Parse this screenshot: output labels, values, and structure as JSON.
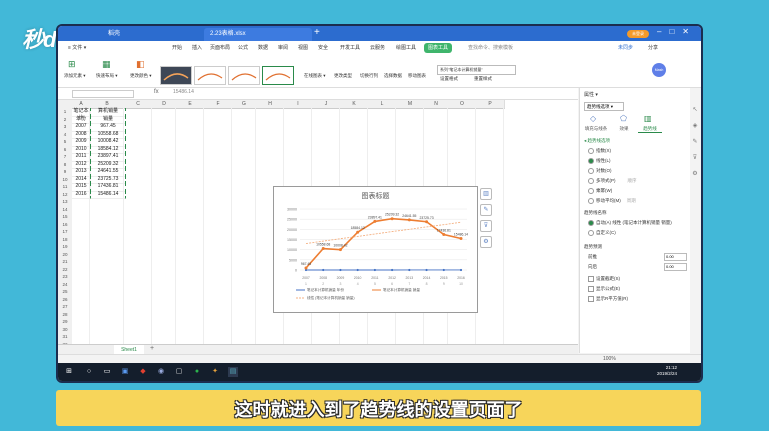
{
  "logo": "秒dong视频",
  "window": {
    "tabs": [
      "稻壳",
      "2.23表格.xlsx"
    ],
    "login_button": "未登录"
  },
  "menubar": {
    "items": [
      "≡ 文件 ▾",
      "开始",
      "插入",
      "页面布局",
      "公式",
      "数据",
      "审阅",
      "视图",
      "安全",
      "开发工具",
      "云服务",
      "绘图工具",
      "图表工具",
      "查找命令、搜索模板"
    ],
    "share": "分享",
    "sync": "未同步"
  },
  "ribbon": {
    "buttons": [
      "添加元素 ▾",
      "快速布局 ▾",
      "更改颜色 ▾",
      "在线图表 ▾",
      "更改类型",
      "切换行列",
      "选择数据",
      "移动图表",
      "设置格式",
      "重置样式"
    ],
    "series_select": "系列\"笔记本计算机销量\"",
    "avatar": "Mash"
  },
  "formula": {
    "fx": "fx",
    "value": "15486.14"
  },
  "sheet": {
    "columns": [
      "A",
      "B",
      "C",
      "D",
      "E",
      "F",
      "G",
      "H",
      "I",
      "J",
      "K",
      "L",
      "M",
      "N",
      "O",
      "P"
    ],
    "rows": [
      "1",
      "2",
      "3",
      "4",
      "5",
      "6",
      "7",
      "8",
      "9",
      "10",
      "11",
      "12",
      "13",
      "14",
      "15",
      "16",
      "17",
      "18",
      "19",
      "20",
      "21",
      "22",
      "23",
      "24",
      "25",
      "26",
      "27",
      "28",
      "29",
      "30",
      "31",
      "32",
      "33"
    ],
    "header_a1": "笔记本计",
    "header_a2": "年份",
    "header_b1": "算机销量",
    "header_b2": "销量",
    "years": [
      "2007",
      "2008",
      "2009",
      "2010",
      "2011",
      "2012",
      "2013",
      "2014",
      "2015",
      "2016"
    ],
    "sales": [
      "967.45",
      "10558.68",
      "10008.42",
      "18584.12",
      "23897.41",
      "25209.32",
      "24641.55",
      "23725.73",
      "17436.81",
      "15486.14"
    ],
    "tab": "Sheet1"
  },
  "chart_data": {
    "type": "line",
    "title": "图表标题",
    "x": [
      "2007",
      "2008",
      "2009",
      "2010",
      "2011",
      "2012",
      "2013",
      "2014",
      "2015",
      "2016"
    ],
    "xticks": [
      "1",
      "2",
      "3",
      "4",
      "5",
      "6",
      "7",
      "8",
      "9",
      "10"
    ],
    "ylim": [
      0,
      30000
    ],
    "yticks": [
      "0",
      "5000",
      "10000",
      "15000",
      "20000",
      "25000",
      "30000"
    ],
    "series": [
      {
        "name": "笔记本计算机销量 年份",
        "values": [
          1,
          2,
          3,
          4,
          5,
          6,
          7,
          8,
          9,
          10
        ],
        "color": "#4472c4"
      },
      {
        "name": "笔记本计算机销量 销量",
        "values": [
          967.45,
          10558.68,
          10008.42,
          18584.12,
          23897.41,
          25209.32,
          24641.55,
          23725.73,
          17436.81,
          15486.14
        ],
        "color": "#ed7d31"
      },
      {
        "name": "线性 (笔记本计算机销量 销量)",
        "values": [
          13000,
          14200,
          15400,
          16500,
          17700,
          18900,
          20000,
          21200,
          22300,
          23500
        ],
        "color": "#f4b183"
      }
    ],
    "data_labels": [
      "967.45",
      "10558.68",
      "10008.42",
      "18584.12",
      "23897.41",
      "25209.32",
      "24641.55",
      "23725.73",
      "17436.81",
      "15486.14"
    ],
    "legend": "bottom",
    "grid": true
  },
  "pane": {
    "title": "属性 ▾",
    "dropdown": "趋势线选项 ▾",
    "tabs": [
      "填充与线条",
      "效果",
      "趋势线"
    ],
    "section1": "◂ 趋势线选项",
    "options": [
      "指数(X)",
      "线性(L)",
      "对数(O)",
      "多项式(P)",
      "乘幂(W)",
      "移动平均(M)"
    ],
    "order_label": "顺序",
    "period_label": "周期",
    "section2": "趋势线名称",
    "name_auto": "自动(A)   线性 (笔记本计算机销量 销量)",
    "name_custom": "自定义(C)",
    "section3": "趋势预测",
    "forward": "前推",
    "backward": "向后",
    "forward_val": "0.00",
    "backward_val": "0.00",
    "period_unit": "周期",
    "cb1": "设置截距(S)",
    "cb2": "显示公式(E)",
    "cb3": "显示R平方值(R)"
  },
  "status": {
    "zoom": "100%",
    "time": "21:12",
    "date": "2019/2/24"
  },
  "subtitle": "这时就进入到了趋势线的设置页面了"
}
